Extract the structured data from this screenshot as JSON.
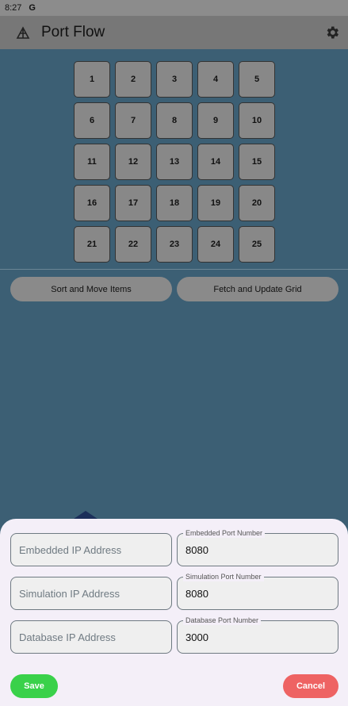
{
  "status_bar": {
    "time": "8:27",
    "google_glyph": "G"
  },
  "app_bar": {
    "title": "Port Flow",
    "logo_icon": "port-logo-icon",
    "settings_icon": "gear-icon"
  },
  "grid": {
    "cells": [
      "1",
      "2",
      "3",
      "4",
      "5",
      "6",
      "7",
      "8",
      "9",
      "10",
      "11",
      "12",
      "13",
      "14",
      "15",
      "16",
      "17",
      "18",
      "19",
      "20",
      "21",
      "22",
      "23",
      "24",
      "25"
    ]
  },
  "actions": {
    "sort_label": "Sort and Move Items",
    "fetch_label": "Fetch and Update Grid"
  },
  "sheet": {
    "rows": [
      {
        "ip_placeholder": "Embedded IP Address",
        "ip_value": "",
        "port_label": "Embedded Port Number",
        "port_value": "8080"
      },
      {
        "ip_placeholder": "Simulation IP Address",
        "ip_value": "",
        "port_label": "Simulation Port Number",
        "port_value": "8080"
      },
      {
        "ip_placeholder": "Database IP Address",
        "ip_value": "",
        "port_label": "Database Port Number",
        "port_value": "3000"
      }
    ],
    "save_label": "Save",
    "cancel_label": "Cancel"
  },
  "colors": {
    "scrim": "#3c5f74",
    "sheet": "#f4eff8",
    "save": "#3ad14a",
    "cancel": "#ee6363"
  }
}
